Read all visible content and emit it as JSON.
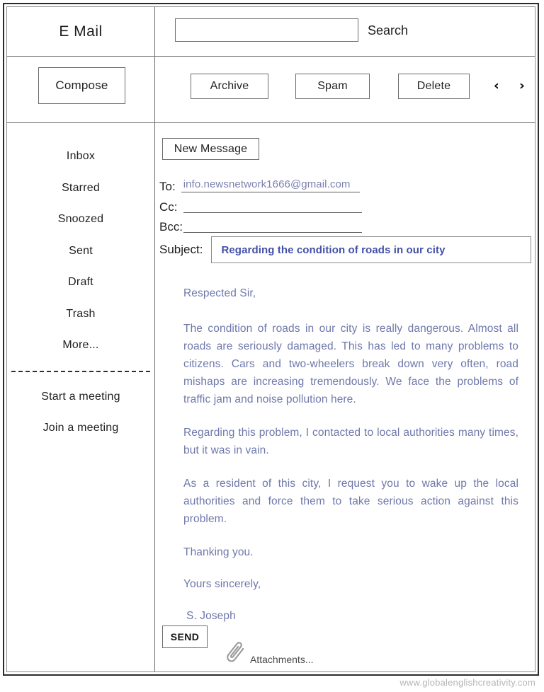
{
  "app": {
    "brand": "E Mail",
    "watermark": "www.globalenglishcreativity.com"
  },
  "search": {
    "label": "Search",
    "value": "",
    "placeholder": ""
  },
  "toolbar": {
    "compose_label": "Compose",
    "archive_label": "Archive",
    "spam_label": "Spam",
    "delete_label": "Delete",
    "prev_arrow": "‹",
    "next_arrow": "›"
  },
  "sidebar": {
    "folders": [
      {
        "label": "Inbox"
      },
      {
        "label": "Starred"
      },
      {
        "label": "Snoozed"
      },
      {
        "label": "Sent"
      },
      {
        "label": "Draft"
      },
      {
        "label": "Trash"
      },
      {
        "label": "More..."
      }
    ],
    "meetings": [
      {
        "label": "Start a meeting"
      },
      {
        "label": "Join a meeting"
      }
    ]
  },
  "compose": {
    "tab_label": "New Message",
    "to_label": "To:",
    "to_value": "info.newsnetwork1666@gmail.com",
    "cc_label": "Cc:",
    "cc_value": "",
    "bcc_label": "Bcc:",
    "bcc_value": "",
    "subject_label": "Subject:",
    "subject_value": "Regarding the condition of roads in our city",
    "send_label": "SEND",
    "attachments_label": "Attachments...",
    "body": {
      "greeting": "Respected Sir,",
      "paragraph_1": "The condition of roads in our city is really dangerous. Almost all roads are seriously damaged. This has led to many problems to citizens. Cars and two-wheelers break down very often, road mishaps are increasing tremendously. We face the problems of traffic jam and noise pollution here.",
      "paragraph_2": "Regarding this problem, I contacted to local authorities many times, but it was in vain.",
      "paragraph_3": "As a resident of this city, I request you to wake up the local authorities and force them to take serious action against this problem.",
      "closing_thanks": "Thanking you.",
      "closing_regards": "Yours sincerely,",
      "signature": "S. Joseph"
    }
  },
  "colors": {
    "body_text": "#6f78ab",
    "subject_text": "#4450a8",
    "field_value": "#7b82ae",
    "frame": "#2b2b2b",
    "watermark": "#b5b5b5"
  }
}
